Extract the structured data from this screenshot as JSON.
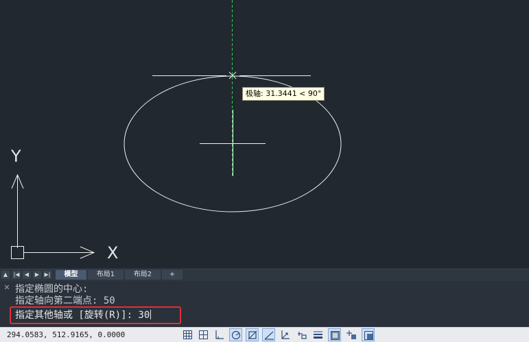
{
  "drawing": {
    "tooltip": "极轴: 31.3441 < 90°",
    "ucs_y_label": "Y",
    "ucs_x_label": "X"
  },
  "layout_tabs": {
    "nav_buttons": [
      "first-icon",
      "previous-icon",
      "next-icon",
      "last-icon"
    ],
    "tabs": [
      {
        "label": "模型",
        "active": true
      },
      {
        "label": "布局1",
        "active": false
      },
      {
        "label": "布局2",
        "active": false
      },
      {
        "label": "+",
        "active": false
      }
    ]
  },
  "command": {
    "history": [
      "指定椭圆的中心:",
      "指定轴向第二端点: 50"
    ],
    "current_prompt": "指定其他轴或 [旋转(R)]: 30"
  },
  "status": {
    "coordinates": "294.0583, 512.9165, 0.0000",
    "buttons": [
      {
        "name": "grid-icon",
        "on": false
      },
      {
        "name": "snap-icon",
        "on": false
      },
      {
        "name": "ortho-icon",
        "on": false
      },
      {
        "name": "polar-icon",
        "on": true
      },
      {
        "name": "osnap-icon",
        "on": true
      },
      {
        "name": "otrack-icon",
        "on": true
      },
      {
        "name": "dynamic-ucs-icon",
        "on": false
      },
      {
        "name": "dynamic-input-icon",
        "on": false
      },
      {
        "name": "lineweight-icon",
        "on": false
      },
      {
        "name": "transparency-icon",
        "on": true
      },
      {
        "name": "selection-cycling-icon",
        "on": false
      },
      {
        "name": "annotation-monitor-icon",
        "on": true
      }
    ]
  }
}
